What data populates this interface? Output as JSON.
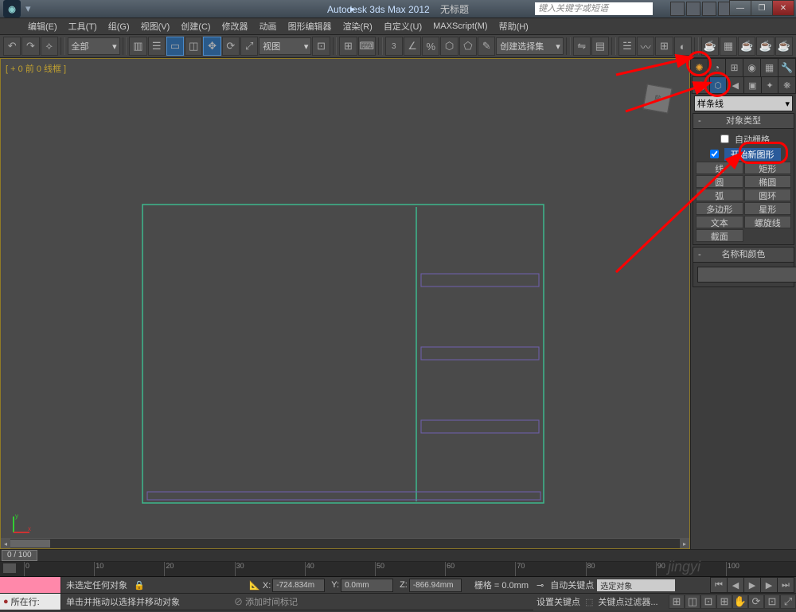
{
  "title": {
    "app": "Autodesk 3ds Max",
    "ver": "2012",
    "untitled": "无标题"
  },
  "search": {
    "placeholder": "键入关键字或短语"
  },
  "menu": [
    "编辑(E)",
    "工具(T)",
    "组(G)",
    "视图(V)",
    "创建(C)",
    "修改器",
    "动画",
    "图形编辑器",
    "渲染(R)",
    "自定义(U)",
    "MAXScript(M)",
    "帮助(H)"
  ],
  "toolbar": {
    "sel_all": "全部",
    "sel_view": "视图",
    "sel_set": "创建选择集"
  },
  "viewport": {
    "label": "[ + 0 前 0 线框 ]"
  },
  "cmd": {
    "dropdown": "样条线",
    "roll_type": "对象类型",
    "autogrid": "自动栅格",
    "start_new": "开始新图形",
    "buttons": [
      [
        "线",
        "矩形"
      ],
      [
        "圆",
        "椭圆"
      ],
      [
        "弧",
        "圆环"
      ],
      [
        "多边形",
        "星形"
      ],
      [
        "文本",
        "螺旋线"
      ],
      [
        "截面",
        ""
      ]
    ],
    "roll_name": "名称和颜色"
  },
  "timeline": {
    "range": "0 / 100"
  },
  "status": {
    "nosel": "未选定任何对象",
    "hint": "单击并拖动以选择并移动对象",
    "now": "所在行:",
    "x": "-724.834m",
    "y": "0.0mm",
    "z": "-866.94mm",
    "grid": "栅格 = 0.0mm",
    "autokey": "自动关键点",
    "selobj": "选定对象",
    "setkey": "设置关键点",
    "keyfilter": "关键点过滤器...",
    "addtime": "添加时间标记",
    "lock": "🔒"
  },
  "watermark": "jingyi"
}
